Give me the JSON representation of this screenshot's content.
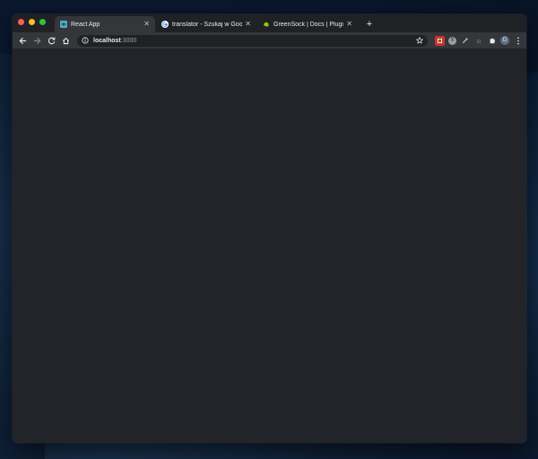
{
  "browser": {
    "tabs": [
      {
        "title": "React App",
        "icon": "react-icon",
        "active": true
      },
      {
        "title": "translator - Szukaj w Google",
        "icon": "google-icon",
        "active": false
      },
      {
        "title": "GreenSock | Docs | Plugins | S",
        "icon": "greensock-icon",
        "active": false
      }
    ],
    "close_glyph": "✕",
    "new_tab_glyph": "+",
    "address": {
      "host": "localhost",
      "port": ":3000"
    },
    "profile_initial": "D",
    "extension_badge": "X"
  },
  "colors": {
    "page_background": "#222429",
    "toolbar": "#35363a",
    "tabstrip": "#202124"
  }
}
